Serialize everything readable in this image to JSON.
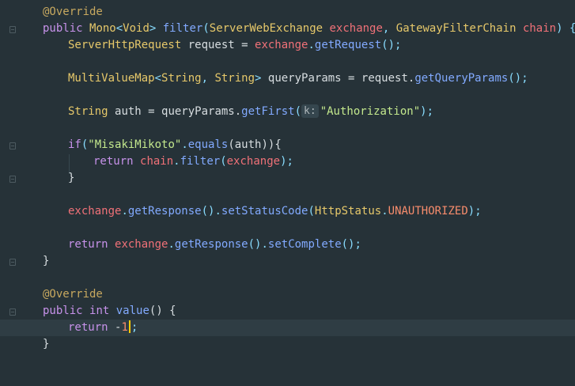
{
  "editor": {
    "lines": {
      "l1": {
        "ann": "@Override"
      },
      "l2": {
        "kw": "public ",
        "t1": "Mono",
        "p1": "<",
        "t2": "Void",
        "p2": "> ",
        "fn": "filter",
        "p3": "(",
        "t3": "ServerWebExchange ",
        "v1": "exchange",
        "p4": ", ",
        "t4": "GatewayFilterChain ",
        "v2": "chain",
        "p5": ") {"
      },
      "l3": {
        "t1": "ServerHttpRequest ",
        "plain1": "request = ",
        "v1": "exchange",
        "p1": ".",
        "fn": "getRequest",
        "p2": "();"
      },
      "l5": {
        "t1": "MultiValueMap",
        "p1": "<",
        "t2": "String",
        "p2": ", ",
        "t3": "String",
        "p3": "> ",
        "plain1": "queryParams = request.",
        "fn": "getQueryParams",
        "p4": "();"
      },
      "l7": {
        "t1": "String ",
        "plain1": "auth = queryParams.",
        "fn": "getFirst",
        "p1": "(",
        "hint": "k:",
        "str": "\"Authorization\"",
        "p2": ");"
      },
      "l9": {
        "kw": "if",
        "p1": "(",
        "str": "\"MisakiMikoto\"",
        "p2": ".",
        "fn": "equals",
        "p3": "(auth)){"
      },
      "l10": {
        "kw": "return ",
        "v1": "chain",
        "p1": ".",
        "fn": "filter",
        "p2": "(",
        "v2": "exchange",
        "p3": ");"
      },
      "l11": {
        "p1": "}"
      },
      "l13": {
        "v1": "exchange",
        "p1": ".",
        "fn1": "getResponse",
        "p2": "().",
        "fn2": "setStatusCode",
        "p3": "(",
        "t1": "HttpStatus",
        "p4": ".",
        "c1": "UNAUTHORIZED",
        "p5": ");"
      },
      "l15": {
        "kw": "return ",
        "v1": "exchange",
        "p1": ".",
        "fn1": "getResponse",
        "p2": "().",
        "fn2": "setComplete",
        "p3": "();"
      },
      "l16": {
        "p1": "}"
      },
      "l18": {
        "ann": "@Override"
      },
      "l19": {
        "kw1": "public ",
        "kw2": "int ",
        "fn": "value",
        "p1": "() {"
      },
      "l20": {
        "kw": "return ",
        "p1": "-",
        "c1": "1",
        "p2": ";"
      },
      "l21": {
        "p1": "}"
      }
    }
  }
}
